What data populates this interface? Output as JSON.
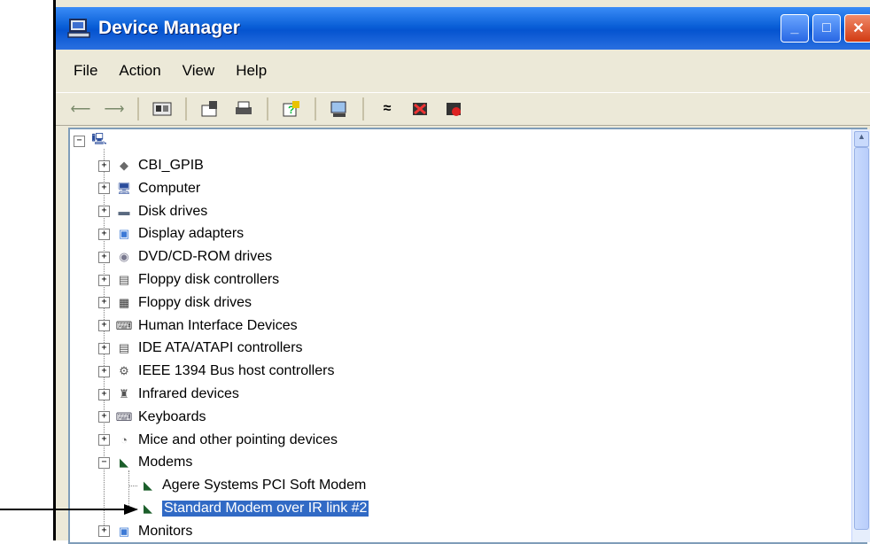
{
  "window": {
    "title": "Device Manager",
    "controls": {
      "minimize": "_",
      "maximize": "□",
      "close": "✕"
    }
  },
  "menu": {
    "items": [
      "File",
      "Action",
      "View",
      "Help"
    ]
  },
  "toolbar": {
    "icons": [
      "back-icon",
      "forward-icon",
      "console-icon",
      "properties-icon",
      "print-icon",
      "help-icon",
      "scan-icon",
      "update-driver-icon",
      "uninstall-icon",
      "disable-icon"
    ]
  },
  "tree": {
    "root_icon": "computer-icon",
    "items": [
      {
        "label": "CBI_GPIB",
        "icon": "diamond-icon",
        "expander": "+"
      },
      {
        "label": "Computer",
        "icon": "computer-icon",
        "expander": "+"
      },
      {
        "label": "Disk drives",
        "icon": "disk-icon",
        "expander": "+"
      },
      {
        "label": "Display adapters",
        "icon": "display-icon",
        "expander": "+"
      },
      {
        "label": "DVD/CD-ROM drives",
        "icon": "cdrom-icon",
        "expander": "+"
      },
      {
        "label": "Floppy disk controllers",
        "icon": "controller-icon",
        "expander": "+"
      },
      {
        "label": "Floppy disk drives",
        "icon": "floppy-icon",
        "expander": "+"
      },
      {
        "label": "Human Interface Devices",
        "icon": "hid-icon",
        "expander": "+"
      },
      {
        "label": "IDE ATA/ATAPI controllers",
        "icon": "ide-icon",
        "expander": "+"
      },
      {
        "label": "IEEE 1394 Bus host controllers",
        "icon": "ieee1394-icon",
        "expander": "+"
      },
      {
        "label": "Infrared devices",
        "icon": "infrared-icon",
        "expander": "+"
      },
      {
        "label": "Keyboards",
        "icon": "keyboard-icon",
        "expander": "+"
      },
      {
        "label": "Mice and other pointing devices",
        "icon": "mouse-icon",
        "expander": "+"
      },
      {
        "label": "Modems",
        "icon": "modem-icon",
        "expander": "−"
      },
      {
        "label": "Agere Systems PCI Soft Modem",
        "icon": "modem-icon",
        "child": true
      },
      {
        "label": "Standard Modem over IR link #2",
        "icon": "modem-icon",
        "child": true,
        "selected": true
      },
      {
        "label": "Monitors",
        "icon": "monitor-icon",
        "expander": "+"
      }
    ]
  },
  "colors": {
    "selection": "#316ac5",
    "titlebar": "#0a5fd7"
  }
}
